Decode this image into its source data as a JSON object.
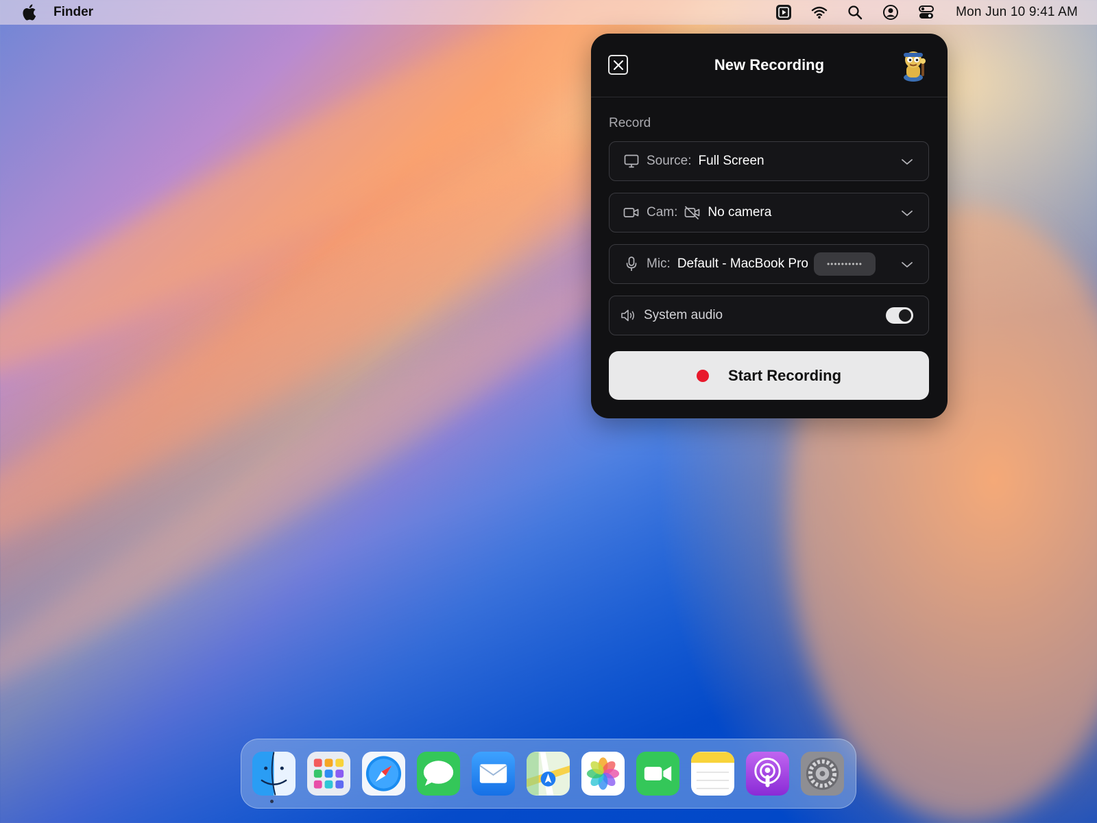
{
  "menubar": {
    "app_name": "Finder",
    "clock": "Mon Jun 10  9:41 AM",
    "icons": [
      "apple-logo-icon",
      "screen-recorder-icon",
      "wifi-icon",
      "search-icon",
      "user-account-icon",
      "control-center-icon"
    ]
  },
  "panel": {
    "title": "New Recording",
    "section_label": "Record",
    "source": {
      "key": "Source:",
      "value": "Full Screen",
      "icon": "monitor-icon"
    },
    "cam": {
      "key": "Cam:",
      "value": "No camera",
      "icon": "video-camera-icon"
    },
    "mic": {
      "key": "Mic:",
      "value": "Default - MacBook Pro",
      "icon": "microphone-icon",
      "level_indicator": "••••••••••"
    },
    "system_audio": {
      "label": "System audio",
      "icon": "speaker-icon",
      "enabled": true
    },
    "start_button": "Start Recording",
    "accent": "#e8192c"
  },
  "dock": {
    "apps": [
      "Finder",
      "Launchpad",
      "Safari",
      "Messages",
      "Mail",
      "Maps",
      "Photos",
      "FaceTime",
      "Notes",
      "Podcasts",
      "System Settings"
    ]
  }
}
